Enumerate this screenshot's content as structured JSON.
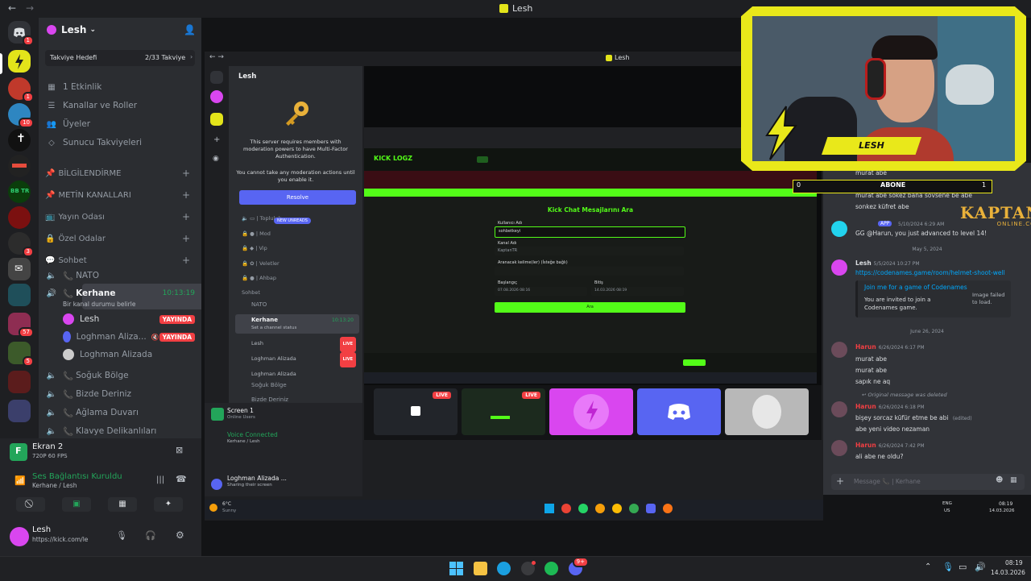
{
  "titlebar": {
    "title": "Lesh"
  },
  "server": {
    "name": "Lesh"
  },
  "boost": {
    "label": "Takviye Hedefi",
    "progress": "2/33 Takviye"
  },
  "menu": [
    "1 Etkinlik",
    "Kanallar ve Roller",
    "Üyeler",
    "Sunucu Takviyeleri"
  ],
  "categories": [
    {
      "label": "BİLGİLENDİRME"
    },
    {
      "label": "METİN KANALLARI"
    },
    {
      "label": "Yayın Odası"
    },
    {
      "label": "Özel Odalar"
    },
    {
      "label": "Sohbet"
    }
  ],
  "voice": {
    "nato": "NATO",
    "kerhane": "Kerhane",
    "kerhane_time": "10:13:19",
    "kerhane_status": "Bir kanal durumu belirle",
    "users": [
      {
        "name": "Lesh",
        "badge": "YAYINDA"
      },
      {
        "name": "Loghman Aliza...",
        "badge": "YAYINDA"
      },
      {
        "name": "Loghman Alizada",
        "badge": ""
      }
    ],
    "others": [
      "Soğuk Bölge",
      "Bizde Deriniz",
      "Ağlama Duvarı",
      "Klavye Delikanlıları"
    ]
  },
  "stream": {
    "name": "Ekran 2",
    "quality": "720P 60 FPS"
  },
  "connection": {
    "status": "Ses Bağlantısı Kuruldu",
    "channel": "Kerhane / Lesh"
  },
  "user": {
    "name": "Lesh",
    "status": "https://kick.com/le"
  },
  "rail_badges": [
    "1",
    "1",
    "10",
    "3",
    "57",
    "5"
  ],
  "rail_label": "BB TR",
  "inner": {
    "title": "Lesh",
    "server_name": "Lesh",
    "mfa_text": "This server requires members with moderation powers to have Multi-Factor Authentication.",
    "mfa_sub": "You cannot take any moderation actions until you enable it.",
    "resolve": "Resolve",
    "new_unreads": "NEW UNREADS",
    "channels": [
      "Topluluk",
      "Mod",
      "Vip",
      "Veletler",
      "Ahbap"
    ],
    "sohbet": "Sohbet",
    "nato": "NATO",
    "kerhane": "Kerhane",
    "kerhane_time": "10:13:20",
    "kerhane_status": "Set a channel status",
    "users": [
      {
        "name": "Lesh",
        "badge": "LIVE"
      },
      {
        "name": "Loghman Alizada",
        "badge": "LIVE"
      },
      {
        "name": "Loghman Alizada",
        "badge": ""
      }
    ],
    "soguk": "Soğuk Bölge",
    "bizde": "Bizde Deriniz",
    "screen": "Screen 1",
    "screen_sub": "Online Users",
    "voice_connected": "Voice Connected",
    "voice_channel": "Kerhane / Lesh",
    "user": "Loghman Alizada ...",
    "user_status": "Sharing their screen"
  },
  "page": {
    "brand": "KICK LOGZ",
    "title": "Kick Chat Mesajlarını Ara",
    "username_label": "Kullanıcı Adı",
    "username_value": "sohbetkeyi",
    "channel_label": "Kanal Adı",
    "channel_value": "KaptanTR",
    "search_label": "Aranacak kelime(ler) (İsteğe bağlı)",
    "start_label": "Başlangıç",
    "end_label": "Bitiş",
    "start_value": "07.08.2026 08:16",
    "end_value": "14.03.2026 08:19",
    "search_button": "Ara",
    "tiles_live": "LIVE"
  },
  "chat": {
    "top_lines": [
      "murat abe",
      "murat abe",
      "murat abe sokez bana sövsene be abe",
      "sonkez küfret abe"
    ],
    "abone_label": "ABONE",
    "abone_left": "0",
    "abone_right": "1",
    "app_badge": "APP",
    "app_time": "5/10/2024 6:29 AM",
    "app_msg": "GG @Harun, you just advanced to level 14!",
    "date1": "May 5, 2024",
    "lesh_time": "5/5/2024 10:27 PM",
    "lesh_name": "Lesh",
    "link": "https://codenames.game/room/helmet-shoot-well",
    "embed_title": "Join me for a game of Codenames",
    "embed_text": "You are invited to join a Codenames game.",
    "embed_fail": "Image failed to load.",
    "date2": "June 26, 2024",
    "harun_name": "Harun",
    "harun_time": "6/26/2024 6:17 PM",
    "harun_lines": [
      "murat abe",
      "murat abe",
      "sapık ne aq"
    ],
    "deleted": "Original message was deleted",
    "harun_time2": "6/26/2024 6:18 PM",
    "harun_msg2": "bişey sorcaz küfür etme be abi",
    "edited": "(edited)",
    "harun_msg3": "abe yeni video nezaman",
    "harun_time3": "6/26/2024 7:42 PM",
    "harun_msg4": "ali abe ne oldu?",
    "input_placeholder": "Message 📞 | Kerhane"
  },
  "cam": {
    "name": "LESH"
  },
  "watermark": {
    "line1": "KAPTAN",
    "line2": "ONLINE.COM"
  },
  "inner_taskbar": {
    "weather": "6°C",
    "weather_sub": "Sunny",
    "lang": "ENG",
    "lang_sub": "US",
    "time": "08:19",
    "date": "14.03.2026"
  },
  "taskbar": {
    "time": "08:19",
    "date": "14.03.2026",
    "notif": "9+"
  },
  "colors": {
    "accent": "#5865f2",
    "live": "#f23f43",
    "green": "#23a55a",
    "kick": "#53fc18",
    "cam": "#e9e81a"
  }
}
